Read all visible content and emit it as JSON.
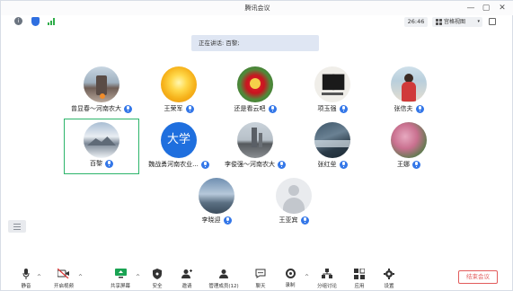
{
  "window": {
    "title": "腾讯会议",
    "controls": {
      "minimize": "—",
      "maximize": "▢",
      "close": "✕"
    }
  },
  "status_bar": {
    "timer": "26:46",
    "view_button": "宫格视图",
    "view_caret": "▾"
  },
  "speaking_banner": "正在讲话: 百黎;",
  "participants": [
    {
      "name": "曾显春～河南农大",
      "avatar": "pier-photo"
    },
    {
      "name": "王荣军",
      "avatar": "sun-photo"
    },
    {
      "name": "还是看云吧",
      "avatar": "red-flower-photo"
    },
    {
      "name": "项玉强",
      "avatar": "calligraphy-photo"
    },
    {
      "name": "张信夫",
      "avatar": "woman-photo"
    },
    {
      "name": "百黎",
      "avatar": "snow-mountain-photo",
      "active": true
    },
    {
      "name": "魏战勇河南农业...",
      "avatar": "text-avatar",
      "avatar_text": "大学"
    },
    {
      "name": "李俊强～河南农大",
      "avatar": "building-photo"
    },
    {
      "name": "张红垒",
      "avatar": "coast-photo"
    },
    {
      "name": "王娜",
      "avatar": "blossom-photo"
    },
    {
      "name": "李晓迎",
      "avatar": "sky-photo"
    },
    {
      "name": "王亚宾",
      "avatar": "default-person"
    }
  ],
  "toolbar": {
    "mute": "静音",
    "start_video": "开启视频",
    "share_screen": "共享屏幕",
    "security": "安全",
    "invite": "邀请",
    "manage_members": "管理成员(12)",
    "chat": "聊天",
    "record": "录制",
    "breakout": "分组讨论",
    "apps": "应用",
    "settings": "设置",
    "end_meeting": "结束会议"
  },
  "colors": {
    "active_border": "#2cb56a",
    "mic_badge": "#3477e8",
    "end_meeting": "#e25b5b",
    "banner_bg": "#dfe6f3"
  }
}
